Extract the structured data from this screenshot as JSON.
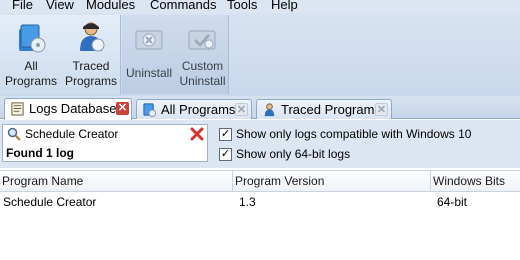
{
  "menu": [
    "File",
    "View",
    "Modules",
    "Commands",
    "Tools",
    "Help"
  ],
  "ribbon": {
    "programs_group": [
      {
        "label": "All\nPrograms",
        "icon": "all-programs-icon"
      },
      {
        "label": "Traced\nPrograms",
        "icon": "traced-programs-icon"
      }
    ],
    "uninstall_group": [
      {
        "label": "Uninstall",
        "icon": "uninstall-icon"
      },
      {
        "label": "Custom\nUninstall",
        "icon": "custom-uninstall-icon"
      }
    ]
  },
  "tabs": [
    {
      "label": "Logs Database",
      "icon": "logs-database-icon",
      "active": true
    },
    {
      "label": "All Programs",
      "icon": "all-programs-tab-icon",
      "active": false
    },
    {
      "label": "Traced Programs",
      "icon": "traced-programs-tab-icon",
      "active": false
    }
  ],
  "filter": {
    "search_value": "Schedule Creator",
    "found_text": "Found 1 log",
    "options": [
      {
        "label": "Show only logs compatible with Windows 10",
        "checked": true
      },
      {
        "label": "Show only 64-bit logs",
        "checked": true
      }
    ]
  },
  "table": {
    "columns": [
      "Program Name",
      "Program Version",
      "Windows Bits"
    ],
    "rows": [
      [
        "Schedule Creator",
        "1.3",
        "64-bit"
      ]
    ]
  },
  "colors": {
    "accent": "#c9433b",
    "panel": "#dce6f3"
  }
}
